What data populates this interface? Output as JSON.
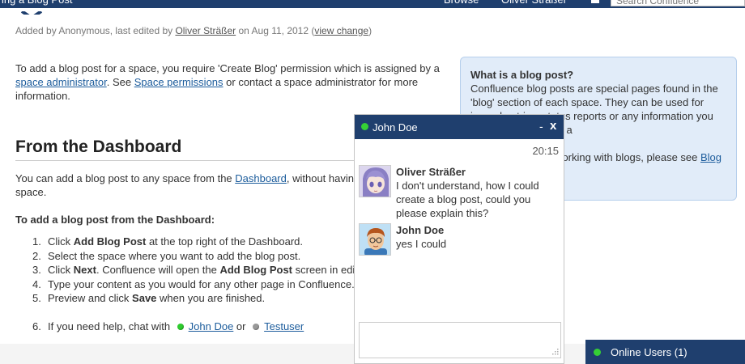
{
  "topbar": {
    "breadcrumb": "ing a Blog Post",
    "browse": "Browse",
    "user": "Oliver Sträßer",
    "search_placeholder": "Search Confluence"
  },
  "meta": {
    "added_by": "Added by Anonymous, last edited by ",
    "editor": "Oliver Sträßer",
    "on_date": " on Aug 11, 2012  (",
    "view_change": "view change",
    "close_paren": ")"
  },
  "intro": {
    "part1": "To add a blog post for a space, you require 'Create Blog' permission which is assigned by a ",
    "link1": "space administrator",
    "part2": ". See ",
    "link2": "Space permissions",
    "part3": " or contact a space administrator for more information."
  },
  "sidebar": {
    "heading": "What is a blog post?",
    "text1": "Confluence blog posts are special pages found in the 'blog' section of each space. They can be used for journal entries, status reports or any information you would categorise as a",
    "text2": "Read more about working with blogs, please see ",
    "link": "Blog Section",
    "text3": "."
  },
  "section": {
    "title": "From the Dashboard",
    "text1": "You can add a blog post to any space from the ",
    "link": "Dashboard",
    "text2": ", without having to navigate to the space.",
    "subheading": "To add a blog post from the Dashboard:"
  },
  "steps": [
    {
      "num": "1.",
      "pre": "Click ",
      "bold": "Add Blog Post",
      "post": " at the top right of the Dashboard.",
      "bold2": "",
      "post2": ""
    },
    {
      "num": "2.",
      "pre": "Select the space where you want to add the blog post.",
      "bold": "",
      "post": "",
      "bold2": "",
      "post2": ""
    },
    {
      "num": "3.",
      "pre": "Click ",
      "bold": "Next",
      "post": ". Confluence will open the ",
      "bold2": "Add Blog Post",
      "post2": " screen in edit mode."
    },
    {
      "num": "4.",
      "pre": "Type your content as you would for any other page in Confluence.",
      "bold": "",
      "post": "",
      "bold2": "",
      "post2": ""
    },
    {
      "num": "5.",
      "pre": "Preview and click ",
      "bold": "Save",
      "post": " when you are finished.",
      "bold2": "",
      "post2": ""
    }
  ],
  "step6": {
    "num": "6.",
    "text": "If you need help, chat with ",
    "user1": "John Doe",
    "or": " or ",
    "user2": "Testuser"
  },
  "chat": {
    "title": "John Doe",
    "minimize": "-",
    "close": "x",
    "time": "20:15",
    "messages": [
      {
        "sender": "Oliver Sträßer",
        "text": "I don't understand, how I could create a blog post, could you please explain this?"
      },
      {
        "sender": "John Doe",
        "text": "yes I could"
      }
    ]
  },
  "online": {
    "label": "Online Users (1)"
  },
  "colors": {
    "nav_blue": "#1f3f6e",
    "link_blue": "#1c5c9c",
    "online_green": "#2ecc2e",
    "info_box_bg": "#e1ecf9"
  },
  "icons": {
    "status_online": "green-dot",
    "status_offline": "gray-dot",
    "resize": "resize-grip-icon"
  }
}
